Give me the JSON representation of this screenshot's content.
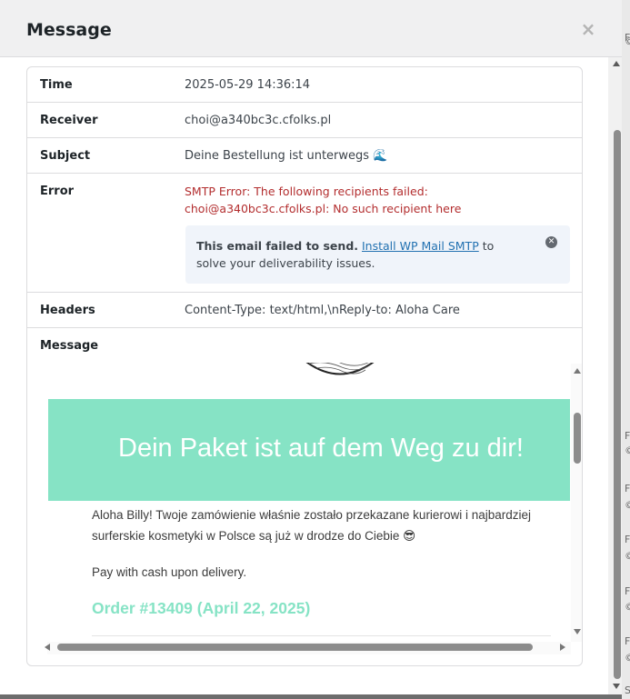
{
  "modal": {
    "title": "Message",
    "close_glyph": "×"
  },
  "details": {
    "rows": [
      {
        "label": "Time",
        "value": "2025-05-29 14:36:14"
      },
      {
        "label": "Receiver",
        "value": "choi@a340bc3c.cfolks.pl"
      },
      {
        "label": "Subject",
        "value": "Deine Bestellung ist unterwegs 🌊"
      },
      {
        "label": "Error",
        "value": "SMTP Error: The following recipients failed: choi@a340bc3c.cfolks.pl: No such recipient here"
      },
      {
        "label": "Headers",
        "value": "Content-Type: text/html,\\nReply-to: Aloha Care"
      },
      {
        "label": "Message",
        "value": ""
      }
    ],
    "notice": {
      "bold": "This email failed to send.",
      "link": "Install WP Mail SMTP",
      "rest": " to solve your deliverability issues.",
      "close_glyph": "✕"
    }
  },
  "email": {
    "hero_title": "Dein Paket ist auf dem Weg zu dir!",
    "greeting": "Aloha Billy! Twoje zamówienie właśnie zostało przekazane kurierowi i najbardziej surferskie kosmetyki w Polsce są już w drodze do Ciebie 😎",
    "payment_note": "Pay with cash upon delivery.",
    "order_heading": "Order #13409 (April 22, 2025)",
    "hero_color": "#86e3c5"
  },
  "background": {
    "fragments": [
      "F",
      "©",
      "F",
      "©",
      "F",
      "©",
      "F",
      "©",
      "F",
      "©",
      "F",
      "©",
      "Sh"
    ]
  }
}
